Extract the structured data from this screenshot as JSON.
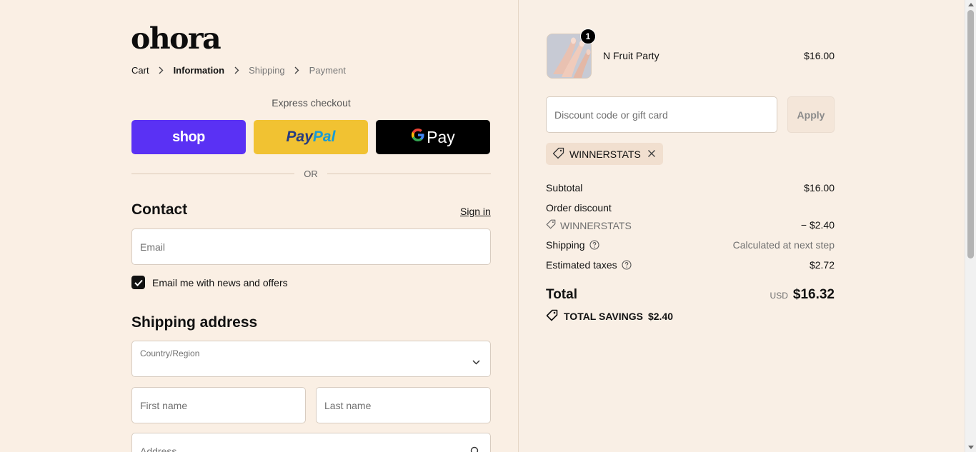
{
  "brand": {
    "logo": "ohora"
  },
  "breadcrumb": [
    {
      "label": "Cart"
    },
    {
      "label": "Information"
    },
    {
      "label": "Shipping"
    },
    {
      "label": "Payment"
    }
  ],
  "express": {
    "title": "Express checkout",
    "shop_label": "shop",
    "paypal_part1": "Pay",
    "paypal_part2": "Pal",
    "gpay_g": "G",
    "gpay_label": "Pay",
    "or_label": "OR"
  },
  "contact": {
    "title": "Contact",
    "sign_in": "Sign in",
    "email_placeholder": "Email",
    "news_checkbox_label": "Email me with news and offers",
    "news_checked": true
  },
  "shipping_address": {
    "title": "Shipping address",
    "country_label": "Country/Region",
    "first_name_placeholder": "First name",
    "last_name_placeholder": "Last name",
    "address_placeholder": "Address"
  },
  "summary": {
    "product": {
      "name": "N Fruit Party",
      "price": "$16.00",
      "quantity": "1"
    },
    "discount_placeholder": "Discount code or gift card",
    "apply_label": "Apply",
    "applied_code": "WINNERSTATS",
    "subtotal_label": "Subtotal",
    "subtotal_value": "$16.00",
    "order_discount_label": "Order discount",
    "discount_code": "WINNERSTATS",
    "discount_value": "− $2.40",
    "shipping_label": "Shipping",
    "shipping_value": "Calculated at next step",
    "taxes_label": "Estimated taxes",
    "taxes_value": "$2.72",
    "total_label": "Total",
    "total_currency": "USD",
    "total_value": "$16.32",
    "savings_label": "TOTAL SAVINGS",
    "savings_value": "$2.40"
  },
  "colors": {
    "background": "#faefe4",
    "shop_pay": "#5a31f4",
    "paypal": "#f1c232",
    "gpay": "#000000",
    "chip": "#f1dfcf"
  }
}
